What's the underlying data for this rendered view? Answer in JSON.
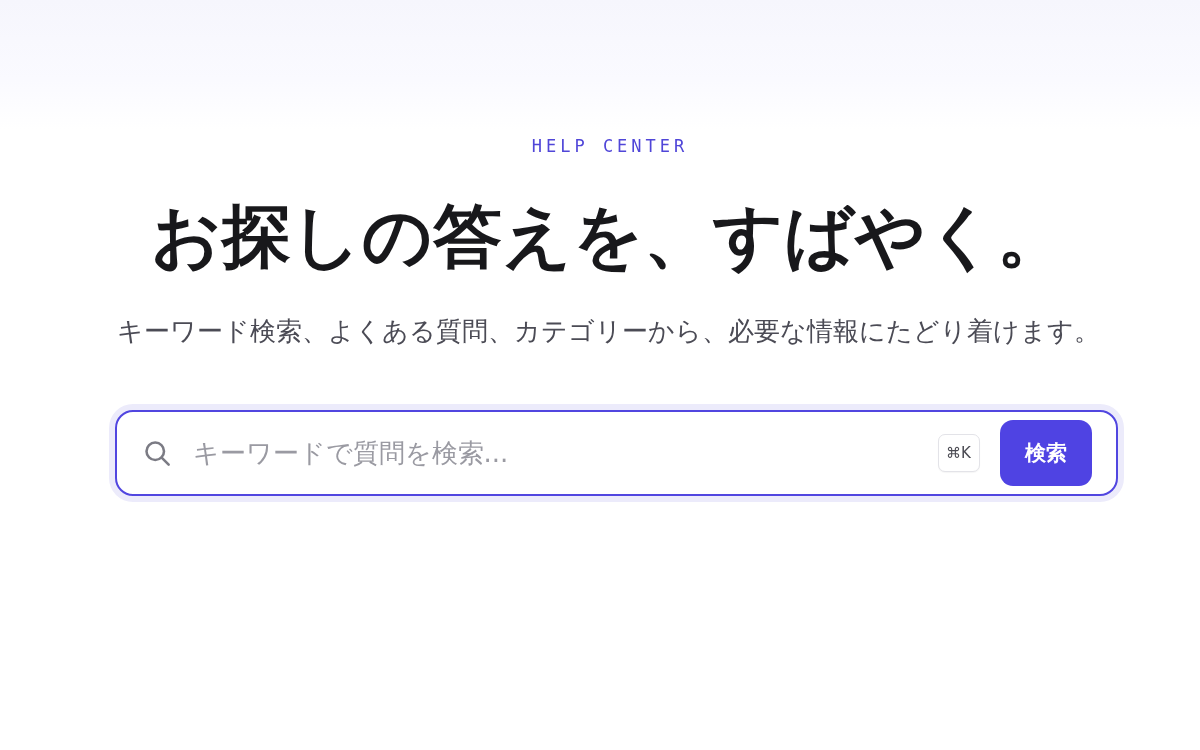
{
  "eyebrow": "HELP CENTER",
  "heading": "お探しの答えを、すばやく。",
  "subheading": "キーワード検索、よくある質問、カテゴリーから、必要な情報にたどり着けます。",
  "search": {
    "placeholder": "キーワードで質問を検索...",
    "focused": true,
    "shortcut": "⌘K",
    "button": "検索"
  }
}
